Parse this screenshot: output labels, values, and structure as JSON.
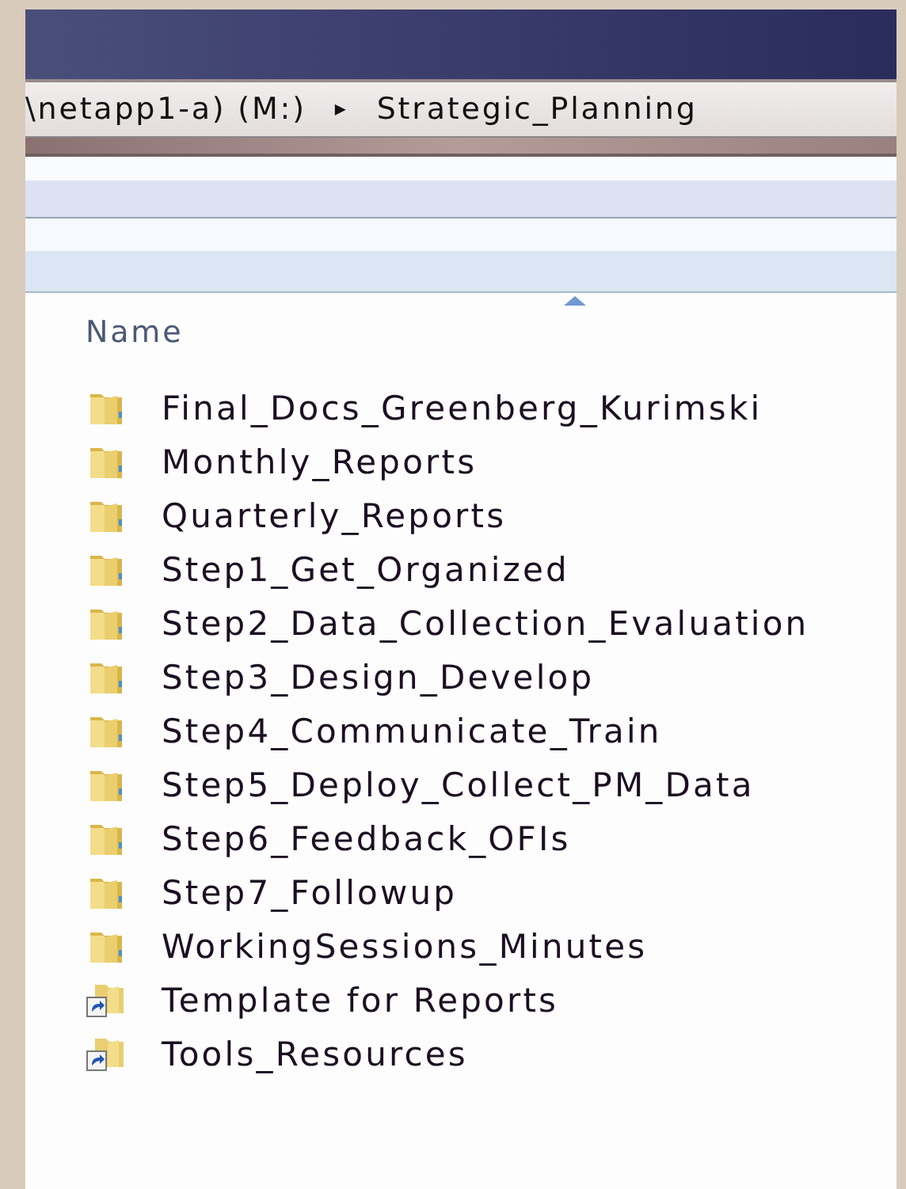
{
  "address_bar": {
    "segments": [
      {
        "kind": "text",
        "label": "\\netapp1-a) (M:)"
      },
      {
        "kind": "separator",
        "label": "▸"
      },
      {
        "kind": "text",
        "label": "Strategic_Planning"
      }
    ]
  },
  "file_list": {
    "columns": [
      {
        "label": "Name",
        "sorted": true
      }
    ],
    "items": [
      {
        "name": "Final_Docs_Greenberg_Kurimski",
        "kind": "folder"
      },
      {
        "name": "Monthly_Reports",
        "kind": "folder"
      },
      {
        "name": "Quarterly_Reports",
        "kind": "folder"
      },
      {
        "name": "Step1_Get_Organized",
        "kind": "folder"
      },
      {
        "name": "Step2_Data_Collection_Evaluation",
        "kind": "folder"
      },
      {
        "name": "Step3_Design_Develop",
        "kind": "folder"
      },
      {
        "name": "Step4_Communicate_Train",
        "kind": "folder"
      },
      {
        "name": "Step5_Deploy_Collect_PM_Data",
        "kind": "folder"
      },
      {
        "name": "Step6_Feedback_OFIs",
        "kind": "folder"
      },
      {
        "name": "Step7_Followup",
        "kind": "folder"
      },
      {
        "name": "WorkingSessions_Minutes",
        "kind": "folder"
      },
      {
        "name": "Template for Reports",
        "kind": "shortcut"
      },
      {
        "name": "Tools_Resources",
        "kind": "shortcut"
      }
    ]
  }
}
